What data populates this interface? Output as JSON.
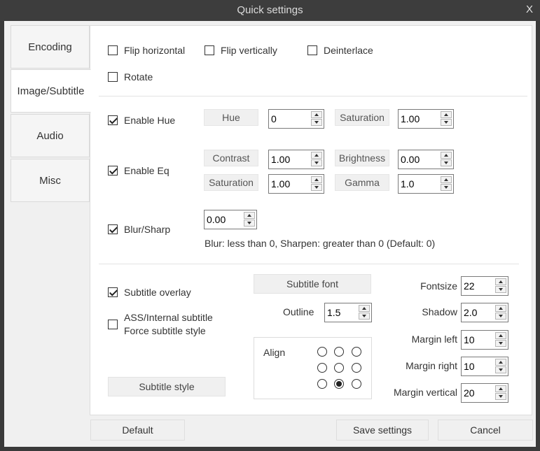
{
  "window": {
    "title": "Quick settings",
    "close_label": "X"
  },
  "tabs": [
    {
      "label": "Encoding"
    },
    {
      "label": "Image/Subtitle"
    },
    {
      "label": "Audio"
    },
    {
      "label": "Misc"
    }
  ],
  "transform": {
    "flip_horizontal": {
      "label": "Flip horizontal",
      "checked": false
    },
    "flip_vertically": {
      "label": "Flip vertically",
      "checked": false
    },
    "deinterlace": {
      "label": "Deinterlace",
      "checked": false
    },
    "rotate": {
      "label": "Rotate",
      "checked": false
    }
  },
  "hue": {
    "enable_label": "Enable Hue",
    "enabled": true,
    "hue_label": "Hue",
    "hue_value": "0",
    "saturation_label": "Saturation",
    "saturation_value": "1.00"
  },
  "eq": {
    "enable_label": "Enable Eq",
    "enabled": true,
    "contrast_label": "Contrast",
    "contrast_value": "1.00",
    "brightness_label": "Brightness",
    "brightness_value": "0.00",
    "saturation_label": "Saturation",
    "saturation_value": "1.00",
    "gamma_label": "Gamma",
    "gamma_value": "1.0"
  },
  "blur": {
    "enable_label": "Blur/Sharp",
    "enabled": true,
    "value": "0.00",
    "hint": "Blur: less than 0, Sharpen: greater than 0 (Default: 0)"
  },
  "subtitle": {
    "overlay_label": "Subtitle overlay",
    "overlay_checked": true,
    "force_label_line1": "ASS/Internal subtitle",
    "force_label_line2": "Force subtitle style",
    "force_checked": false,
    "style_button": "Subtitle style",
    "font_button": "Subtitle font",
    "outline_label": "Outline",
    "outline_value": "1.5",
    "align_label": "Align",
    "align_selected": 7,
    "fontsize_label": "Fontsize",
    "fontsize_value": "22",
    "shadow_label": "Shadow",
    "shadow_value": "2.0",
    "margin_left_label": "Margin left",
    "margin_left_value": "10",
    "margin_right_label": "Margin right",
    "margin_right_value": "10",
    "margin_vertical_label": "Margin vertical",
    "margin_vertical_value": "20"
  },
  "footer": {
    "default_label": "Default",
    "save_label": "Save settings",
    "cancel_label": "Cancel"
  }
}
